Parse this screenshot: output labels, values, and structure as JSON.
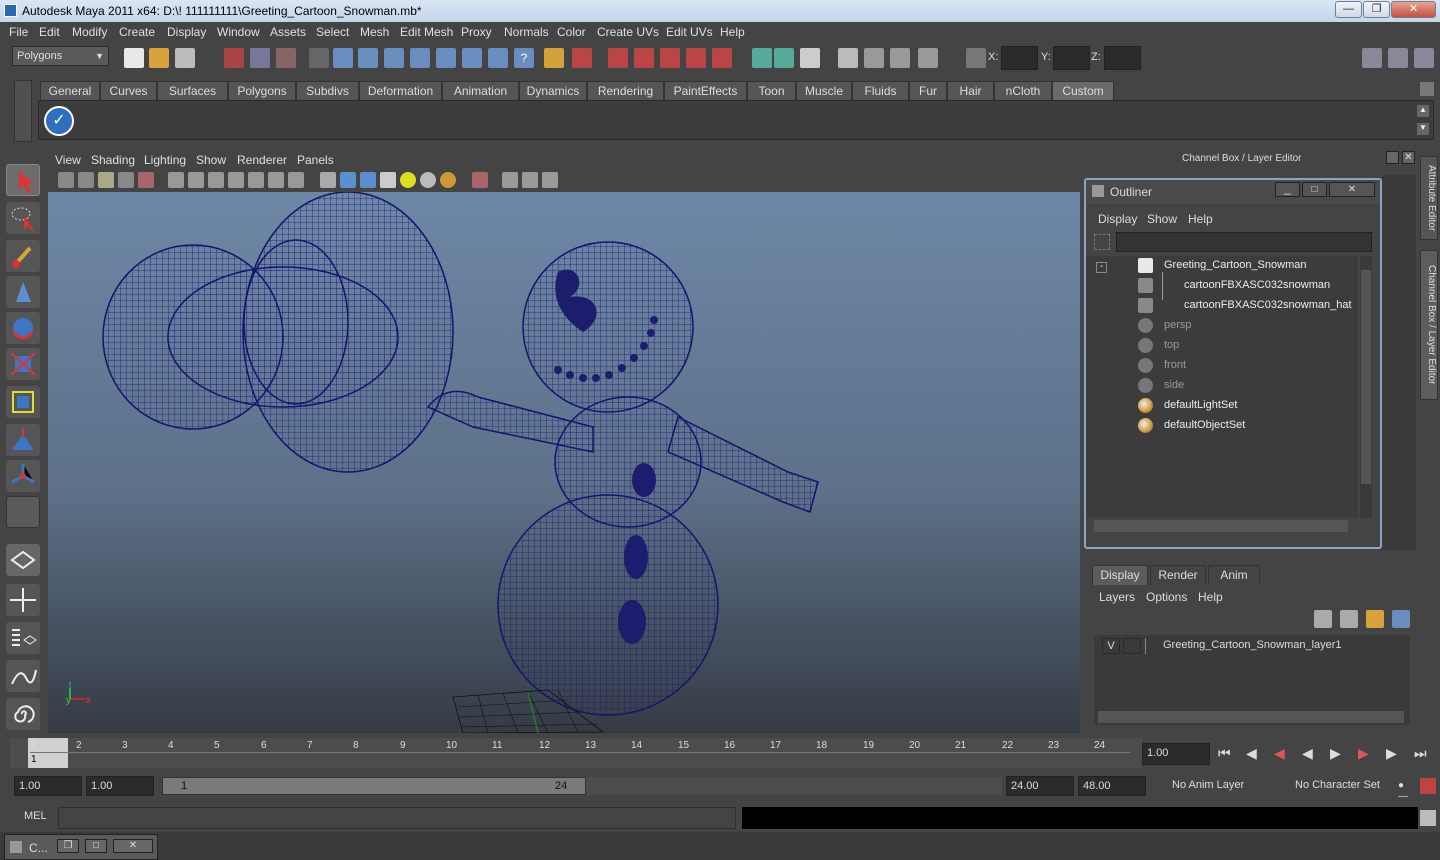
{
  "window": {
    "title": "Autodesk Maya 2011 x64: D:\\! 111111111\\Greeting_Cartoon_Snowman.mb*"
  },
  "menus": [
    "File",
    "Edit",
    "Modify",
    "Create",
    "Display",
    "Window",
    "Assets",
    "Select",
    "Mesh",
    "Edit Mesh",
    "Proxy",
    "Normals",
    "Color",
    "Create UVs",
    "Edit UVs",
    "Help"
  ],
  "status": {
    "mode": "Polygons",
    "x_label": "X:",
    "y_label": "Y:",
    "z_label": "Z:"
  },
  "shelf_tabs": [
    "General",
    "Curves",
    "Surfaces",
    "Polygons",
    "Subdivs",
    "Deformation",
    "Animation",
    "Dynamics",
    "Rendering",
    "PaintEffects",
    "Toon",
    "Muscle",
    "Fluids",
    "Fur",
    "Hair",
    "nCloth",
    "Custom"
  ],
  "shelf_active": "Custom",
  "panel_menu": [
    "View",
    "Shading",
    "Lighting",
    "Show",
    "Renderer",
    "Panels"
  ],
  "channel_box": {
    "title": "Channel Box / Layer Editor"
  },
  "outliner": {
    "title": "Outliner",
    "menu": [
      "Display",
      "Show",
      "Help"
    ],
    "items": [
      {
        "label": "Greeting_Cartoon_Snowman",
        "dim": false
      },
      {
        "label": "cartoonFBXASC032snowman",
        "dim": false
      },
      {
        "label": "cartoonFBXASC032snowman_hat",
        "dim": false
      },
      {
        "label": "persp",
        "dim": true
      },
      {
        "label": "top",
        "dim": true
      },
      {
        "label": "front",
        "dim": true
      },
      {
        "label": "side",
        "dim": true
      },
      {
        "label": "defaultLightSet",
        "dim": false
      },
      {
        "label": "defaultObjectSet",
        "dim": false
      }
    ]
  },
  "layers": {
    "tabs": [
      "Display",
      "Render",
      "Anim"
    ],
    "menu": [
      "Layers",
      "Options",
      "Help"
    ],
    "row": {
      "visibility": "V",
      "name": "Greeting_Cartoon_Snowman_layer1"
    }
  },
  "side_tabs": [
    "Attribute Editor",
    "Channel Box / Layer Editor"
  ],
  "timeline": {
    "ticks": [
      "1",
      "2",
      "3",
      "4",
      "5",
      "6",
      "7",
      "8",
      "9",
      "10",
      "11",
      "12",
      "13",
      "14",
      "15",
      "16",
      "17",
      "18",
      "19",
      "20",
      "21",
      "22",
      "23",
      "24"
    ],
    "current_frame": "1",
    "current_value": "1.00"
  },
  "range": {
    "start": "1.00",
    "playback_start": "1.00",
    "slider_start": "1",
    "slider_end": "24",
    "playback_end": "24.00",
    "end": "48.00",
    "anim_layer": "No Anim Layer",
    "character_set": "No Character Set"
  },
  "command": {
    "label": "MEL"
  },
  "taskbar": {
    "label": "C..."
  }
}
